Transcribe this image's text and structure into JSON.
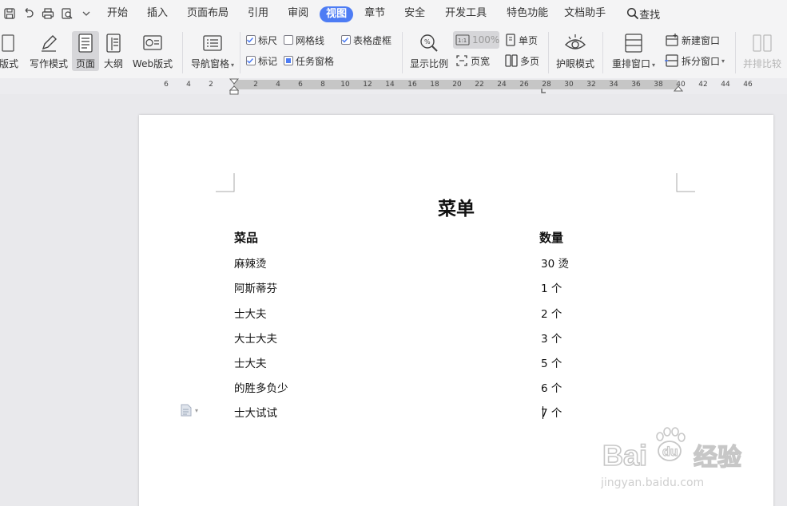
{
  "menubar": {
    "tabs": [
      "开始",
      "插入",
      "页面布局",
      "引用",
      "审阅",
      "视图",
      "章节",
      "安全",
      "开发工具",
      "特色功能",
      "文档助手"
    ],
    "active_tab": "视图",
    "search_label": "查找"
  },
  "ribbon": {
    "partial_layout_label": "版式",
    "writing_mode": "写作模式",
    "page_view": "页面",
    "outline": "大纲",
    "web_layout": "Web版式",
    "navigation_pane": "导航窗格",
    "ruler": "标尺",
    "gridlines": "网格线",
    "table_virtual_border": "表格虚框",
    "marks": "标记",
    "task_pane": "任务窗格",
    "zoom": "显示比例",
    "zoom_value": "100%",
    "page_width": "页宽",
    "single_page": "单页",
    "multi_page": "多页",
    "eye_protection": "护眼模式",
    "arrange_windows": "重排窗口",
    "new_window": "新建窗口",
    "split_window": "拆分窗口",
    "side_by_side": "并排比较",
    "checks": {
      "ruler": true,
      "gridlines": false,
      "table_virtual_border": true,
      "marks": true,
      "task_pane": false
    }
  },
  "ruler_ticks": [
    "6",
    "4",
    "2",
    "2",
    "4",
    "6",
    "8",
    "10",
    "12",
    "14",
    "16",
    "18",
    "20",
    "22",
    "24",
    "26",
    "28",
    "30",
    "32",
    "34",
    "36",
    "38",
    "40",
    "42",
    "44",
    "46"
  ],
  "document": {
    "title": "菜单",
    "headers": [
      "菜品",
      "数量"
    ],
    "rows": [
      [
        "麻辣烫",
        "30 烫"
      ],
      [
        "阿斯蒂芬",
        "1 个"
      ],
      [
        "士大夫",
        "2 个"
      ],
      [
        "大士大夫",
        "3 个"
      ],
      [
        "士大夫",
        "5 个"
      ],
      [
        "的胜多负少",
        "6 个"
      ],
      [
        "士大试试",
        "7 个"
      ]
    ]
  },
  "watermark": {
    "text": "Bai",
    "text2": "du",
    "brand": "经验",
    "url": "jingyan.baidu.com"
  },
  "colors": {
    "accent": "#4d7cf4",
    "ribbon_bg": "#f4f4f5",
    "canvas_bg": "#e9e9ec",
    "check": "#4d7cf4"
  }
}
